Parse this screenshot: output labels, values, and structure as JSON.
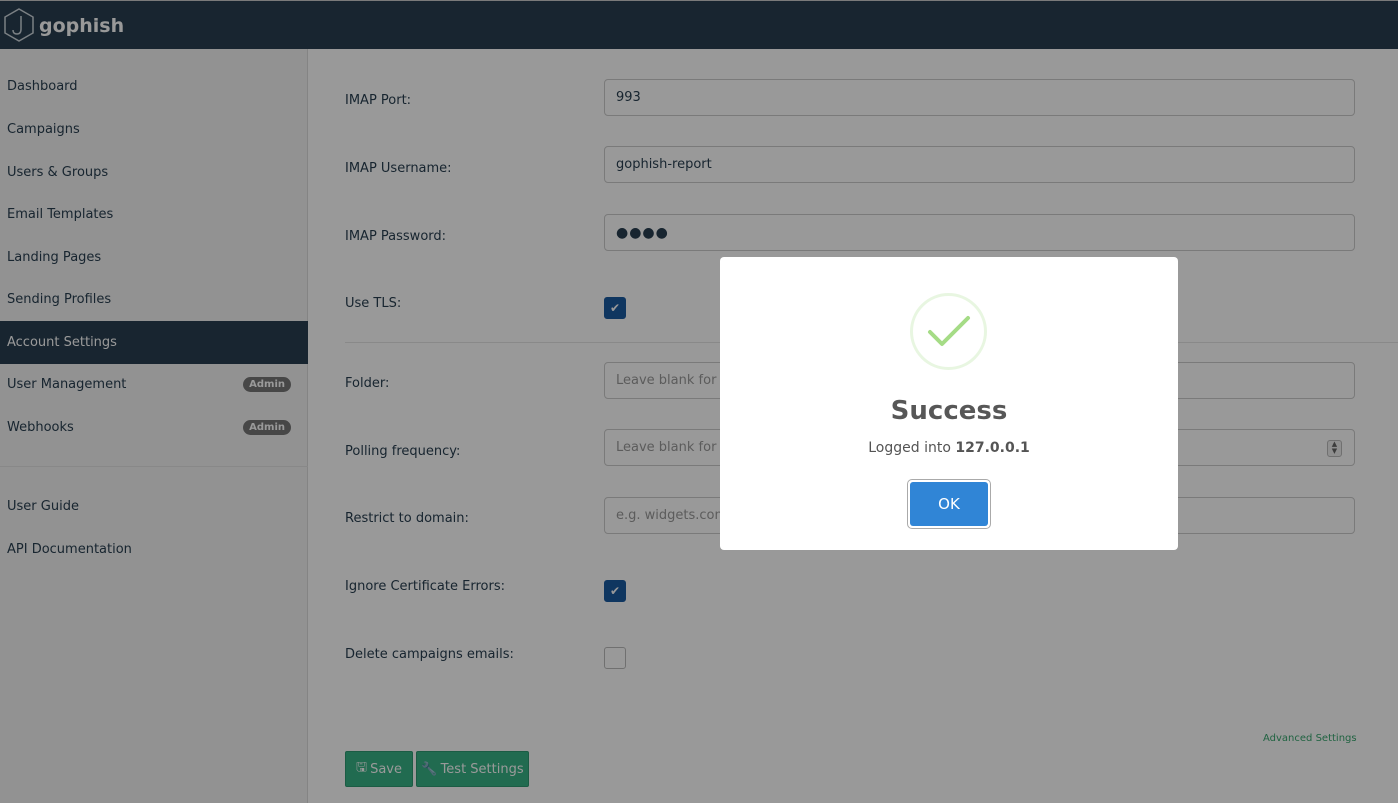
{
  "app": {
    "brand": "gophish"
  },
  "sidebar": {
    "items": [
      {
        "label": "Dashboard"
      },
      {
        "label": "Campaigns"
      },
      {
        "label": "Users & Groups"
      },
      {
        "label": "Email Templates"
      },
      {
        "label": "Landing Pages"
      },
      {
        "label": "Sending Profiles"
      },
      {
        "label": "Account Settings",
        "active": true
      },
      {
        "label": "User Management",
        "badge": "Admin"
      },
      {
        "label": "Webhooks",
        "badge": "Admin"
      },
      {
        "label": "User Guide"
      },
      {
        "label": "API Documentation"
      }
    ]
  },
  "form": {
    "imap_port": {
      "label": "IMAP Port:",
      "value": "993"
    },
    "imap_username": {
      "label": "IMAP Username:",
      "value": "gophish-report"
    },
    "imap_password": {
      "label": "IMAP Password:",
      "value": "●●●●"
    },
    "use_tls": {
      "label": "Use TLS:",
      "checked": true
    },
    "folder": {
      "label": "Folder:",
      "placeholder": "Leave blank for def"
    },
    "polling_frequency": {
      "label": "Polling frequency:",
      "placeholder": "Leave blank for def"
    },
    "restrict_domain": {
      "label": "Restrict to domain:",
      "placeholder": "e.g. widgets.com. L"
    },
    "ignore_cert_errors": {
      "label": "Ignore Certificate Errors:",
      "checked": true
    },
    "delete_campaign_emails": {
      "label": "Delete campaigns emails:",
      "checked": false
    },
    "advanced_link": "Advanced Settings",
    "save_label": "Save",
    "test_label": "Test Settings"
  },
  "modal": {
    "title": "Success",
    "message_prefix": "Logged into",
    "message_host": "127.0.0.1",
    "ok_label": "OK"
  },
  "colors": {
    "navbar": "#283f50",
    "success_button": "#37b386",
    "modal_button": "#3085d6"
  }
}
